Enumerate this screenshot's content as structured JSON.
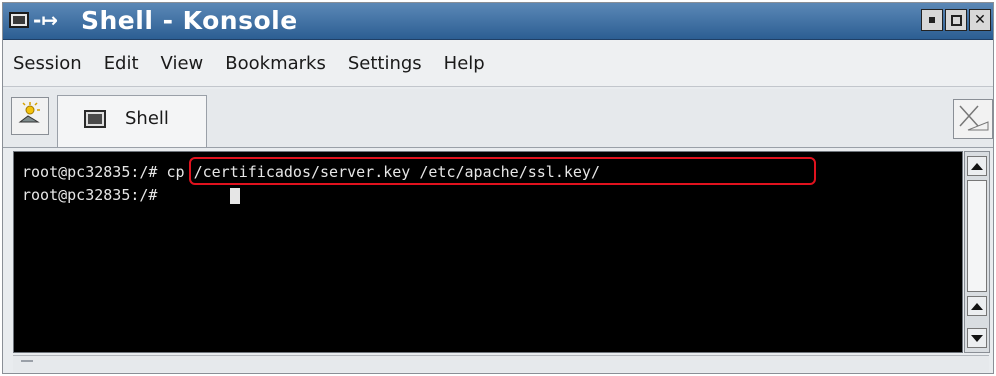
{
  "window": {
    "title": "Shell - Konsole",
    "title_arrow": "-↦"
  },
  "menu": {
    "items": [
      {
        "label": "Session"
      },
      {
        "label": "Edit"
      },
      {
        "label": "View"
      },
      {
        "label": "Bookmarks"
      },
      {
        "label": "Settings"
      },
      {
        "label": "Help"
      }
    ]
  },
  "tabs": [
    {
      "label": "Shell",
      "active": true
    }
  ],
  "terminal": {
    "lines": [
      "root@pc32835:/# cp /certificados/server.key /etc/apache/ssl.key/",
      "root@pc32835:/# "
    ],
    "highlight_color": "#e0121e"
  },
  "colors": {
    "title_bar": "#2c5e93",
    "terminal_bg": "#000000",
    "terminal_fg": "#e6e6e6"
  },
  "icons": {
    "app": "konsole-terminal-icon",
    "new_tab": "new-session-icon",
    "close_tab": "close-session-icon"
  }
}
